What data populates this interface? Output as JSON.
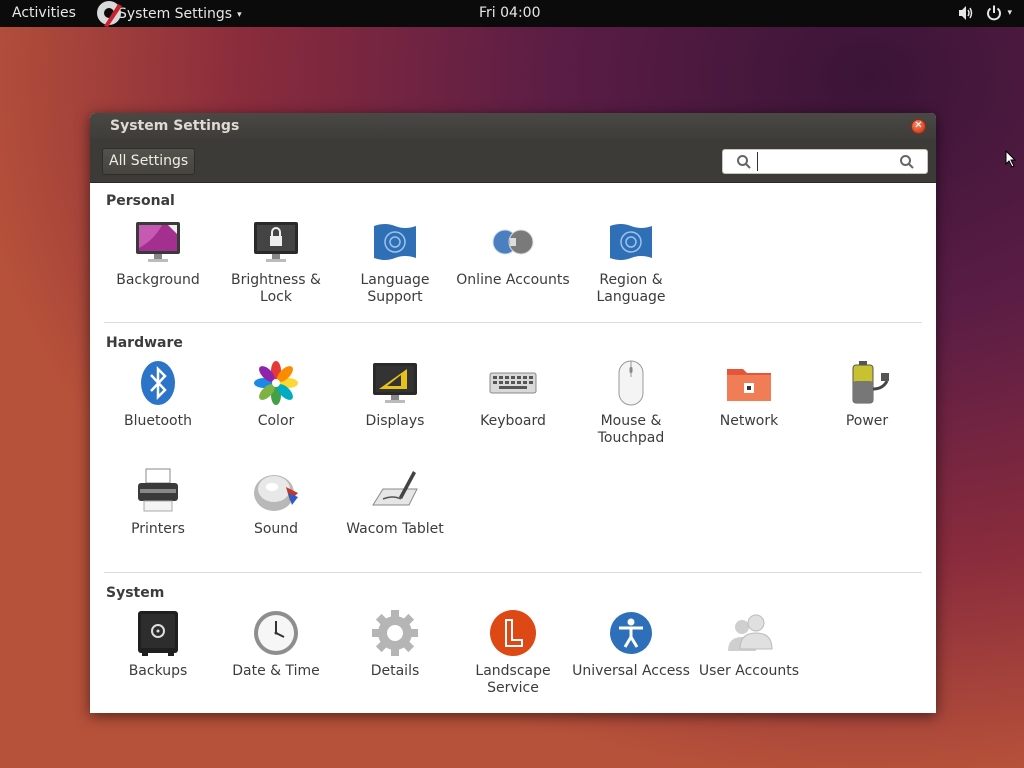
{
  "top_panel": {
    "activities": "Activities",
    "app_menu_label": "System Settings",
    "app_menu_caret": "▾",
    "clock": "Fri 04:00",
    "tray_caret": "▾"
  },
  "window": {
    "title": "System Settings",
    "close_glyph": "✕",
    "all_settings": "All Settings",
    "search": {
      "value": "",
      "placeholder": ""
    }
  },
  "sections": {
    "personal": {
      "title": "Personal",
      "items": [
        {
          "label": "Background",
          "icon": "background-icon"
        },
        {
          "label": "Brightness & Lock",
          "icon": "brightness-lock-icon"
        },
        {
          "label": "Language Support",
          "icon": "language-support-icon"
        },
        {
          "label": "Online Accounts",
          "icon": "online-accounts-icon"
        },
        {
          "label": "Region & Language",
          "icon": "region-language-icon"
        }
      ]
    },
    "hardware": {
      "title": "Hardware",
      "items": [
        {
          "label": "Bluetooth",
          "icon": "bluetooth-icon"
        },
        {
          "label": "Color",
          "icon": "color-icon"
        },
        {
          "label": "Displays",
          "icon": "displays-icon"
        },
        {
          "label": "Keyboard",
          "icon": "keyboard-icon"
        },
        {
          "label": "Mouse & Touchpad",
          "icon": "mouse-icon"
        },
        {
          "label": "Network",
          "icon": "network-icon"
        },
        {
          "label": "Power",
          "icon": "power-battery-icon"
        },
        {
          "label": "Printers",
          "icon": "printer-icon"
        },
        {
          "label": "Sound",
          "icon": "sound-icon"
        },
        {
          "label": "Wacom Tablet",
          "icon": "wacom-tablet-icon"
        }
      ]
    },
    "system": {
      "title": "System",
      "items": [
        {
          "label": "Backups",
          "icon": "backups-safe-icon"
        },
        {
          "label": "Date & Time",
          "icon": "clock-icon"
        },
        {
          "label": "Details",
          "icon": "gear-icon"
        },
        {
          "label": "Landscape Service",
          "icon": "landscape-icon"
        },
        {
          "label": "Universal Access",
          "icon": "accessibility-icon"
        },
        {
          "label": "User Accounts",
          "icon": "users-icon"
        }
      ]
    }
  },
  "colors": {
    "panel": "#0b0b0b",
    "titlebar": "#3f3d39",
    "close": "#d4441e",
    "accent_orange": "#dd4814"
  }
}
